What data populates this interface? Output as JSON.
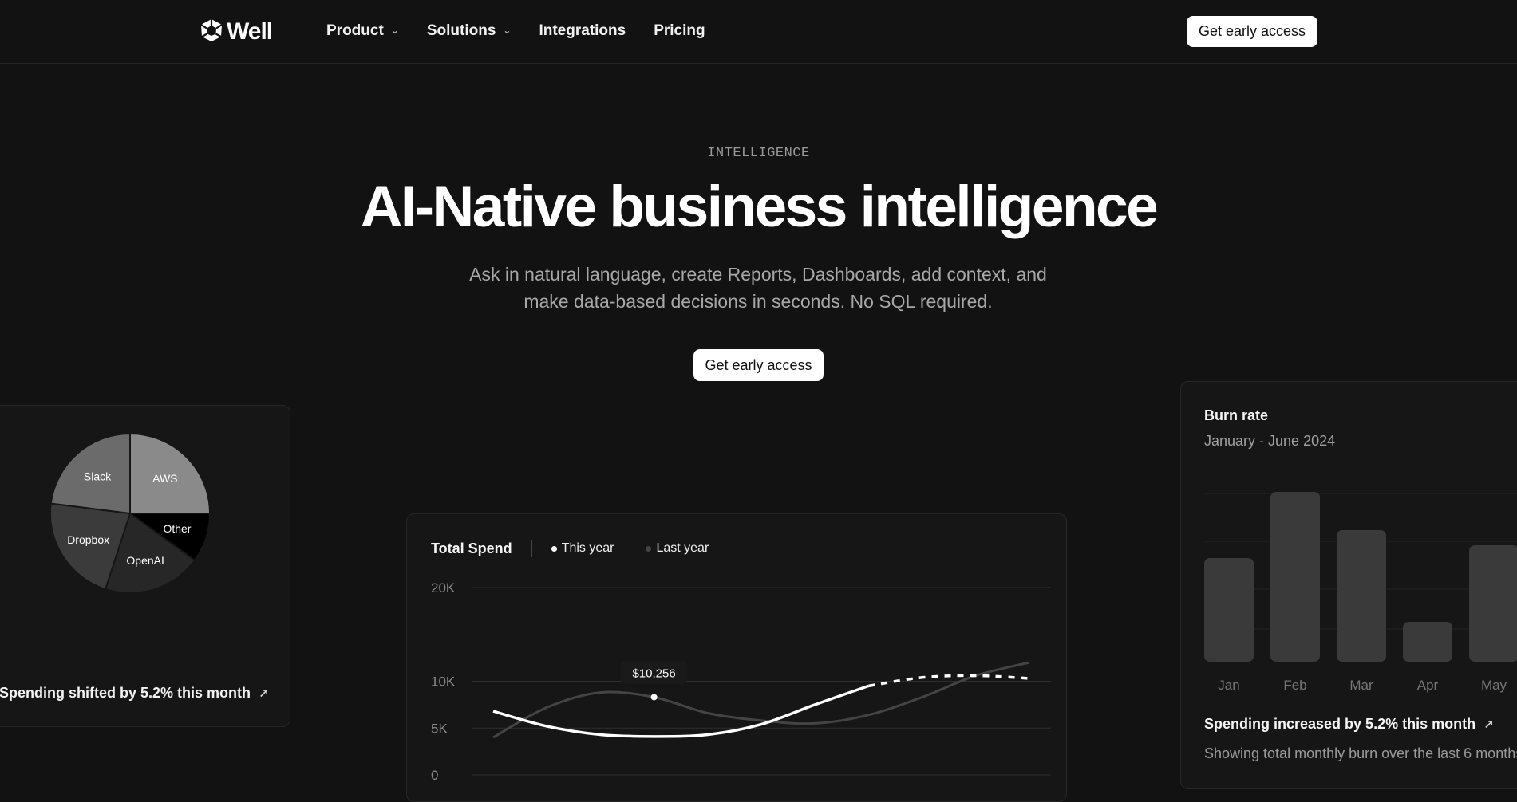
{
  "nav": {
    "logo_text": "Well",
    "items": [
      {
        "label": "Product",
        "has_dropdown": true
      },
      {
        "label": "Solutions",
        "has_dropdown": true
      },
      {
        "label": "Integrations",
        "has_dropdown": false
      },
      {
        "label": "Pricing",
        "has_dropdown": false
      }
    ],
    "cta_label": "Get early access"
  },
  "hero": {
    "eyebrow": "INTELLIGENCE",
    "title": "AI-Native business intelligence",
    "subtitle_line1": "Ask in natural language, create Reports, Dashboards, add context, and",
    "subtitle_line2": "make data-based decisions in seconds. No SQL required.",
    "cta_label": "Get early access"
  },
  "pie_card": {
    "footer": "Spending shifted by 5.2% this month",
    "trend_icon": "trending-up-icon",
    "chart_data": {
      "type": "pie",
      "slices": [
        {
          "label": "AWS",
          "share": 0.25,
          "color": "#8a8a8a"
        },
        {
          "label": "Other",
          "share": 0.1,
          "color": "#000000"
        },
        {
          "label": "OpenAI",
          "share": 0.2,
          "color": "#272727"
        },
        {
          "label": "Dropbox",
          "share": 0.22,
          "color": "#3b3b3b"
        },
        {
          "label": "Slack",
          "share": 0.23,
          "color": "#6b6b6b"
        }
      ]
    }
  },
  "line_card": {
    "title": "Total Spend",
    "legend": [
      {
        "label": "This year",
        "color": "#ffffff"
      },
      {
        "label": "Last year",
        "color": "#444444"
      }
    ],
    "chart_data": {
      "type": "line",
      "yticks": [
        "20K",
        "10K",
        "5K",
        "0"
      ],
      "ylim": [
        0,
        20000
      ],
      "grid": true,
      "tooltip": "$10,256",
      "series": [
        {
          "name": "This year",
          "values": [
            6800,
            5200,
            4300,
            4100,
            4300,
            5400,
            7500,
            9500,
            10400,
            10600,
            10300
          ]
        },
        {
          "name": "Last year",
          "values": [
            4000,
            7200,
            8800,
            8300,
            6600,
            5800,
            5500,
            6400,
            8300,
            10600,
            12000
          ]
        }
      ]
    }
  },
  "bar_card": {
    "title": "Burn rate",
    "subtitle": "January - June 2024",
    "footer": "Spending increased by 5.2% this month",
    "trend_icon": "trending-up-icon",
    "description": "Showing total monthly burn over the last 6 months",
    "chart_data": {
      "type": "bar",
      "categories": [
        "Jan",
        "Feb",
        "Mar",
        "Apr",
        "May"
      ],
      "values": [
        130,
        213,
        165,
        50,
        146
      ],
      "grid": true
    }
  }
}
